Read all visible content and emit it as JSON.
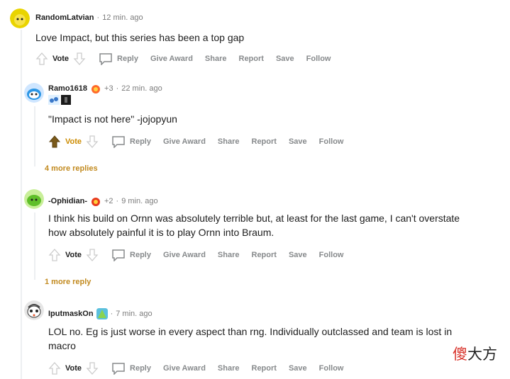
{
  "comments": [
    {
      "author": "RandomLatvian",
      "time": "12 min. ago",
      "text": "Love Impact, but this series has been a top gap",
      "actions": {
        "vote": "Vote",
        "reply": "Reply",
        "give_award": "Give Award",
        "share": "Share",
        "report": "Report",
        "save": "Save",
        "follow": "Follow"
      }
    },
    {
      "author": "Ramo1618",
      "awards": "+3",
      "time": "22 min. ago",
      "text": "\"Impact is not here\" -jojopyun",
      "actions": {
        "vote": "Vote",
        "reply": "Reply",
        "give_award": "Give Award",
        "share": "Share",
        "report": "Report",
        "save": "Save",
        "follow": "Follow"
      },
      "more_replies": "4 more replies"
    },
    {
      "author": "-Ophidian-",
      "awards": "+2",
      "time": "9 min. ago",
      "text_line1": "I think his build on Ornn was absolutely terrible but, at least for the last game, I can't overstate",
      "text_line2": "how absolutely painful it is to play Ornn into Braum.",
      "actions": {
        "vote": "Vote",
        "reply": "Reply",
        "give_award": "Give Award",
        "share": "Share",
        "report": "Report",
        "save": "Save",
        "follow": "Follow"
      },
      "more_replies": "1 more reply"
    },
    {
      "author": "IputmaskOn",
      "time": "7 min. ago",
      "text_line1": "LOL no. Eg is just worse in every aspect than rng. Individually outclassed and team is lost in",
      "text_line2": "macro",
      "actions": {
        "vote": "Vote",
        "reply": "Reply",
        "give_award": "Give Award",
        "share": "Share",
        "report": "Report",
        "save": "Save",
        "follow": "Follow"
      }
    }
  ],
  "separator": "·",
  "watermark": {
    "char1": "傻",
    "char2": "大方"
  },
  "colors": {
    "upvote_active": "#cc8b00",
    "more_replies": "#c28a1f",
    "muted": "#878a8c"
  }
}
